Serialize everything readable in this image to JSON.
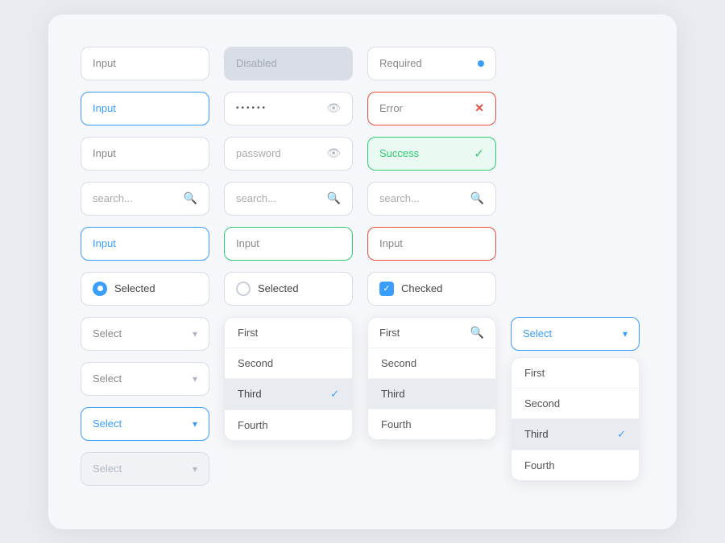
{
  "inputs": {
    "row1": {
      "plain": {
        "label": "Input",
        "state": "normal"
      },
      "disabled": {
        "label": "Disabled",
        "state": "disabled"
      },
      "required": {
        "label": "Required",
        "state": "required"
      }
    },
    "row2": {
      "active": {
        "label": "Input",
        "state": "active"
      },
      "password": {
        "label": "••••••",
        "state": "password"
      },
      "error": {
        "label": "Error",
        "state": "error"
      }
    },
    "row3": {
      "plain": {
        "label": "Input",
        "state": "normal"
      },
      "password_text": {
        "label": "password",
        "state": "password"
      },
      "success": {
        "label": "Success",
        "state": "success"
      }
    },
    "row4": {
      "search1": {
        "label": "search...",
        "state": "search"
      },
      "search2": {
        "label": "search...",
        "state": "search"
      },
      "search3": {
        "label": "search...",
        "state": "search"
      }
    },
    "row5": {
      "blue": {
        "label": "Input",
        "state": "active"
      },
      "green": {
        "label": "Input",
        "state": "green"
      },
      "red": {
        "label": "Input",
        "state": "red"
      }
    }
  },
  "radios": {
    "selected_filled": {
      "label": "Selected",
      "checked": true
    },
    "selected_empty": {
      "label": "Selected",
      "checked": false
    },
    "checked": {
      "label": "Checked",
      "checked": true
    }
  },
  "selects": {
    "col1": [
      {
        "label": "Select",
        "state": "normal"
      },
      {
        "label": "Select",
        "state": "normal"
      },
      {
        "label": "Select",
        "state": "active"
      },
      {
        "label": "Select",
        "state": "disabled"
      }
    ],
    "col4_active": {
      "label": "Select",
      "state": "active"
    }
  },
  "dropdown1": {
    "items": [
      {
        "label": "First",
        "selected": false
      },
      {
        "label": "Second",
        "selected": false
      },
      {
        "label": "Third",
        "selected": true
      },
      {
        "label": "Fourth",
        "selected": false
      }
    ]
  },
  "dropdown2": {
    "search_label": "First",
    "items": [
      {
        "label": "First",
        "selected": false
      },
      {
        "label": "Second",
        "selected": false
      },
      {
        "label": "Third",
        "selected": true
      },
      {
        "label": "Fourth",
        "selected": false
      }
    ]
  },
  "dropdown3": {
    "items": [
      {
        "label": "First",
        "selected": false
      },
      {
        "label": "Second",
        "selected": false
      },
      {
        "label": "Third",
        "selected": true
      },
      {
        "label": "Fourth",
        "selected": false
      }
    ]
  }
}
